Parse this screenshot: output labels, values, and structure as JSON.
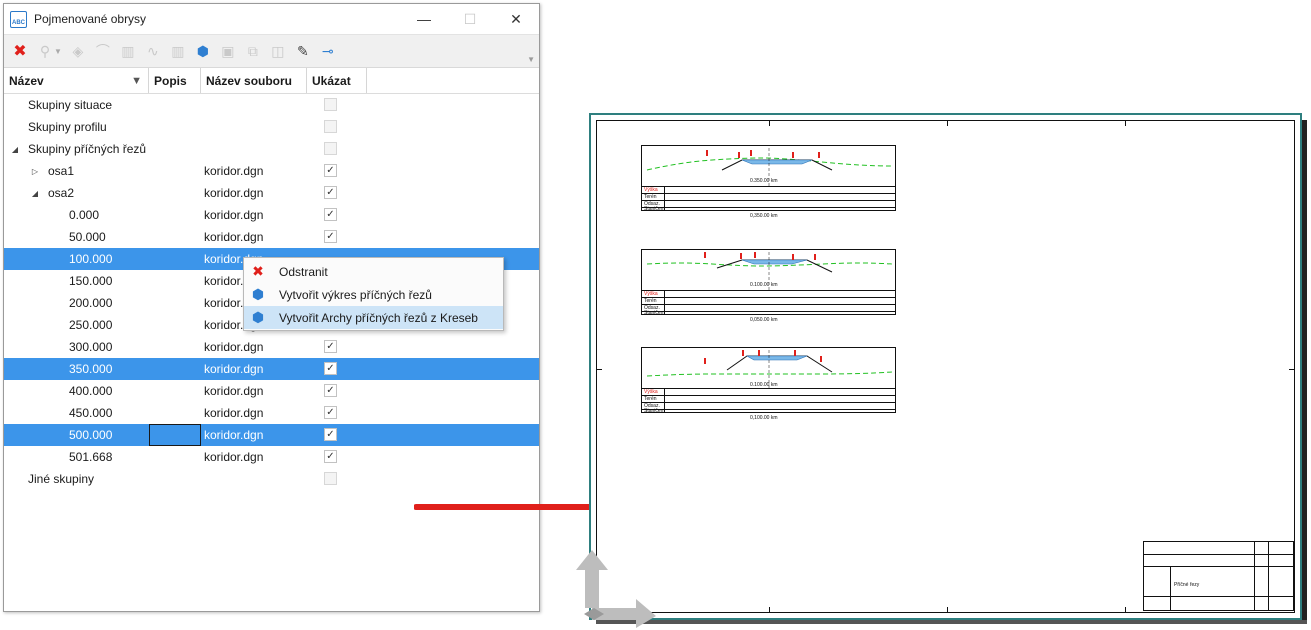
{
  "window": {
    "title": "Pojmenované obrysy",
    "minimize": "—",
    "maximize": "☐",
    "close": "✕"
  },
  "columns": {
    "name": "Název",
    "popis": "Popis",
    "file": "Název souboru",
    "show": "Ukázat"
  },
  "tree": {
    "situace": "Skupiny situace",
    "profilu": "Skupiny profilu",
    "rezu": "Skupiny příčných řezů",
    "osa1": "osa1",
    "osa2": "osa2",
    "jine": "Jiné skupiny",
    "file": "koridor.dgn",
    "stations": [
      "0.000",
      "50.000",
      "100.000",
      "150.000",
      "200.000",
      "250.000",
      "300.000",
      "350.000",
      "400.000",
      "450.000",
      "500.000",
      "501.668"
    ]
  },
  "context_menu": {
    "delete": "Odstranit",
    "create_drawing": "Vytvořit výkres příčných řezů",
    "create_sheets": "Vytvořit Archy příčných řezů z Kreseb"
  },
  "drawing": {
    "row_labels": [
      "Výška",
      "Terén",
      "Odsaz.",
      "Staničení"
    ],
    "km_top": [
      "0.350.00 km",
      "0.100.00 km",
      "0.100.00 km"
    ],
    "km_bottom": [
      "0,350.00 km",
      "0,050.00 km",
      "0,100.00 km"
    ],
    "title_block_text": "Příčné řezy"
  },
  "colors": {
    "selection": "#3c95ea",
    "menu_highlight": "#cde4f7",
    "arrow": "#e0201b",
    "sheet_border": "#2e7f7f"
  }
}
